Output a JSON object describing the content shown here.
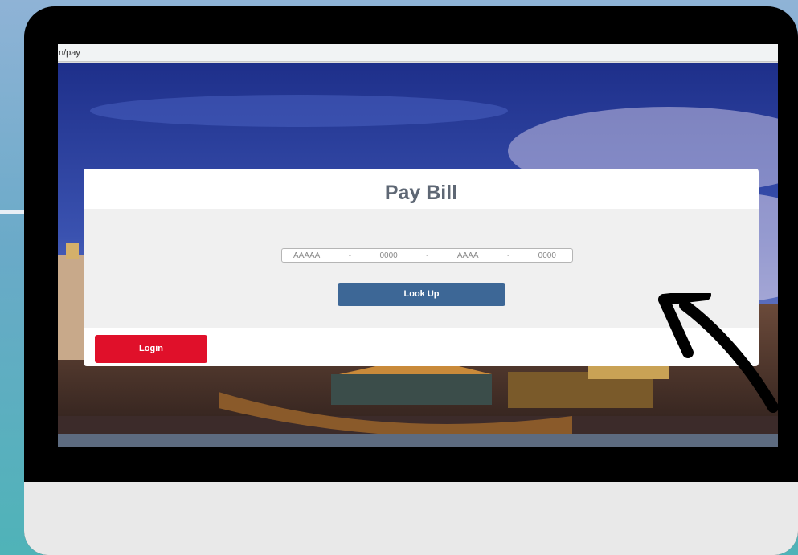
{
  "browser": {
    "url": "n/pay"
  },
  "card": {
    "title": "Pay Bill",
    "account_fields": [
      {
        "placeholder": "AAAAA"
      },
      {
        "separator": "-"
      },
      {
        "placeholder": "0000"
      },
      {
        "separator": "-"
      },
      {
        "placeholder": "AAAA"
      },
      {
        "separator": "-"
      },
      {
        "placeholder": "0000"
      }
    ],
    "lookup_label": "Look Up",
    "login_label": "Login"
  },
  "colors": {
    "lookup_button": "#3d6796",
    "login_button": "#e0102a",
    "title_text": "#5e6774",
    "arrow": "#000000"
  },
  "annotations": {
    "arrow_icon": "hand-drawn-arrow-icon"
  }
}
